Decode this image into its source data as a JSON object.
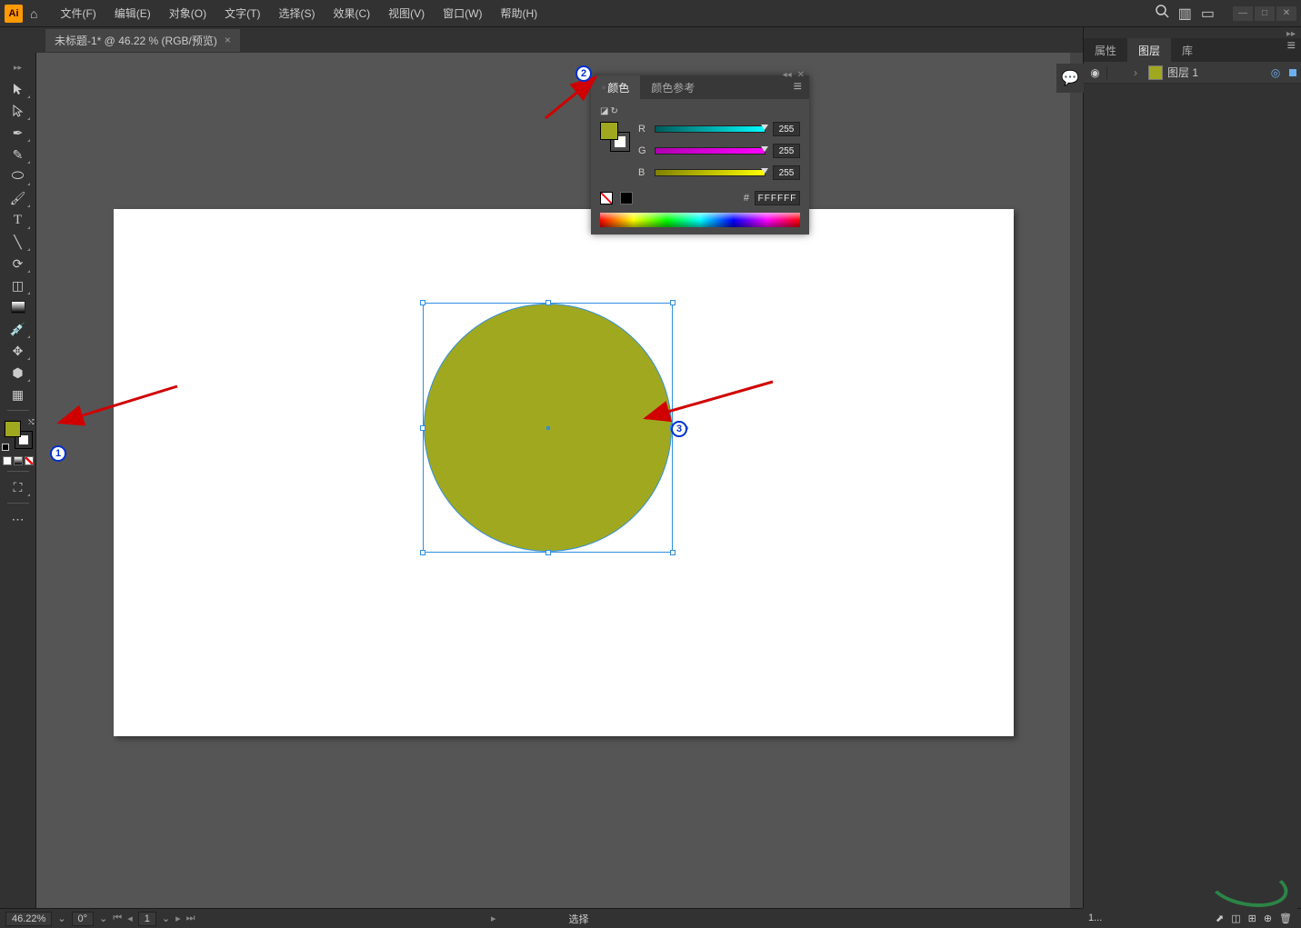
{
  "menu": {
    "file": "文件(F)",
    "edit": "编辑(E)",
    "object": "对象(O)",
    "type": "文字(T)",
    "select": "选择(S)",
    "effect": "效果(C)",
    "view": "视图(V)",
    "window": "窗口(W)",
    "help": "帮助(H)"
  },
  "document": {
    "tab_title": "未标题-1* @ 46.22 % (RGB/预览)"
  },
  "color_panel": {
    "tab_color": "颜色",
    "tab_guide": "颜色参考",
    "r_label": "R",
    "r_value": "255",
    "g_label": "G",
    "g_value": "255",
    "b_label": "B",
    "b_value": "255",
    "hex_label": "#",
    "hex_value": "FFFFFF",
    "fill_color": "#A0A820",
    "stroke_color": "#FFFFFF"
  },
  "right_panel": {
    "tab_props": "属性",
    "tab_layers": "图层",
    "tab_lib": "库",
    "layer_name": "图层 1"
  },
  "statusbar": {
    "zoom": "46.22%",
    "rotation": "0°",
    "artboard_nav": "1",
    "tool_label": "选择",
    "layer_count": "1..."
  },
  "annotations": {
    "n1": "1",
    "n2": "2",
    "n3": "3"
  },
  "canvas": {
    "shape_fill": "#A0A820"
  }
}
